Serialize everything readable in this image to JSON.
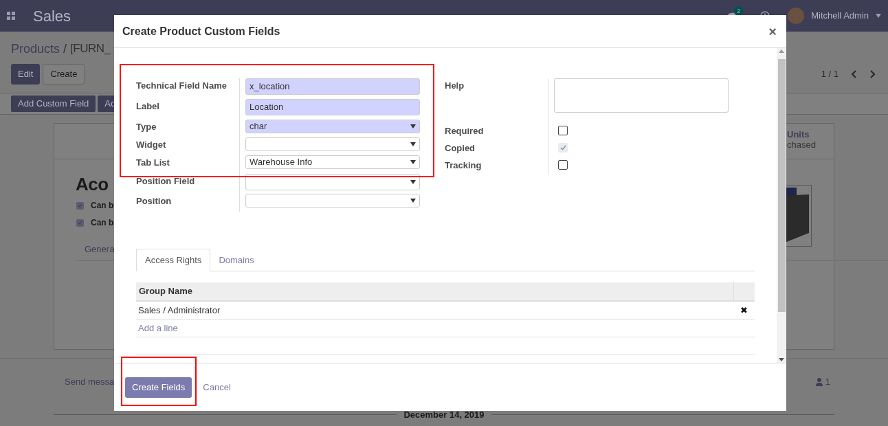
{
  "navbar": {
    "app_title": "Sales",
    "chat_badge": "2",
    "user": "Mitchell Admin"
  },
  "breadcrumb": {
    "root": "Products",
    "separator": "/",
    "current": "[FURN_"
  },
  "buttons": [
    "Edit",
    "Create"
  ],
  "pager": "1 / 1",
  "action_buttons": [
    "Add Custom Field",
    "Ac"
  ],
  "record": {
    "title": "Aco",
    "options": [
      {
        "label": "Can b",
        "checked": true
      },
      {
        "label": "Can b",
        "checked": true
      }
    ],
    "tab": "Genera",
    "stat_value": "Units",
    "stat_label": "chased"
  },
  "chatter": {
    "send": "Send messa",
    "followers": "1",
    "date": "December 14, 2019"
  },
  "dialog": {
    "title": "Create Product Custom Fields",
    "close": "×",
    "left_fields": [
      {
        "label": "Technical Field Name",
        "kind": "text",
        "value": "x_location",
        "required": true
      },
      {
        "label": "Label",
        "kind": "text",
        "value": "Location",
        "required": true
      },
      {
        "label": "Type",
        "kind": "select",
        "value": "char",
        "required": true
      },
      {
        "label": "Widget",
        "kind": "select",
        "required": false
      },
      {
        "label": "Tab List",
        "kind": "select",
        "value": "Warehouse Info",
        "required": false
      },
      {
        "label": "Position Field",
        "kind": "select",
        "required": false
      },
      {
        "label": "Position",
        "kind": "select",
        "required": false
      }
    ],
    "right_fields": [
      {
        "label": "Help",
        "kind": "textarea"
      },
      {
        "label": "Required",
        "kind": "checkbox",
        "checked": false,
        "disabled": false
      },
      {
        "label": "Copied",
        "kind": "checkbox",
        "checked": true,
        "disabled": true
      },
      {
        "label": "Tracking",
        "kind": "checkbox",
        "checked": false,
        "disabled": false
      }
    ],
    "tabs": [
      {
        "label": "Access Rights",
        "selected": true
      },
      {
        "label": "Domains",
        "selected": false
      }
    ],
    "table": {
      "columns": [
        "Group Name"
      ],
      "rows": [
        {
          "group": "Sales / Administrator",
          "delete": "✖"
        }
      ],
      "add_line": "Add a line"
    },
    "buttons": [
      "Create Fields",
      "Cancel"
    ]
  }
}
